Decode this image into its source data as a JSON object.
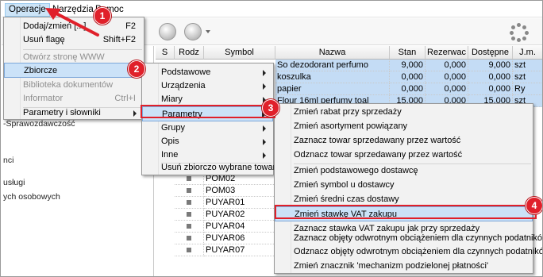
{
  "menubar": [
    "Operacje",
    "Narzędzia",
    "Pomoc"
  ],
  "tree": [
    "-Sprawozdawczość",
    "nci",
    "usługi",
    "ych osobowych"
  ],
  "grid": {
    "headers": [
      "S",
      "Rodz",
      "Symbol",
      "Nazwa",
      "Stan",
      "Rezerwac",
      "Dostępne",
      "J.m."
    ],
    "rows": [
      {
        "symbol": "",
        "name": "So dezodorant perfumo",
        "stan": "9,000",
        "rez": "0,000",
        "dost": "9,000",
        "jm": "szt"
      },
      {
        "symbol": "",
        "name": "koszulka",
        "stan": "0,000",
        "rez": "0,000",
        "dost": "0,000",
        "jm": "szt"
      },
      {
        "symbol": "",
        "name": "papier",
        "stan": "0,000",
        "rez": "0,000",
        "dost": "0,000",
        "jm": "Ry"
      },
      {
        "symbol": "",
        "name": "Flour 16ml perfumy toal",
        "stan": "15,000",
        "rez": "0,000",
        "dost": "15,000",
        "jm": "szt"
      }
    ],
    "lower_rows": [
      "POM02",
      "POM03",
      "PUYAR01",
      "PUYAR02",
      "PUYAR04",
      "PUYAR06",
      "PUYAR07"
    ]
  },
  "menu1": [
    {
      "label": "Dodaj/zmień [...]",
      "key": "F2"
    },
    {
      "label": "Usuń flagę",
      "key": "Shift+F2"
    },
    {
      "label": "Otwórz stronę WWW",
      "disabled": true
    },
    {
      "label": "Zbiorcze",
      "submenu": true
    },
    {
      "label": "Biblioteka dokumentów",
      "disabled": true
    },
    {
      "label": "Informator",
      "key": "Ctrl+I",
      "disabled": true
    },
    {
      "label": "Parametry i słowniki",
      "submenu": true
    }
  ],
  "menu2": [
    {
      "label": "Podstawowe",
      "submenu": true
    },
    {
      "label": "Urządzenia",
      "submenu": true
    },
    {
      "label": "Miary",
      "submenu": true
    },
    {
      "label": "Parametry",
      "submenu": true
    },
    {
      "label": "Grupy",
      "submenu": true
    },
    {
      "label": "Opis",
      "submenu": true
    },
    {
      "label": "Inne",
      "submenu": true
    },
    {
      "label": "Usuń zbiorczo wybrane towary"
    }
  ],
  "menu3": [
    "Zmień rabat przy sprzedaży",
    "Zmień asortyment powiązany",
    "Zaznacz towar sprzedawany przez wartość",
    "Odznacz towar sprzedawany przez wartość",
    "Zmień podstawowego dostawcę",
    "Zmień symbol u dostawcy",
    "Zmień średni czas dostawy",
    "Zmień stawkę VAT zakupu",
    "Zaznacz stawka VAT zakupu jak przy sprzedaży",
    "Zaznacz objęty odwrotnym obciążeniem dla czynnych podatników VAT",
    "Odznacz objęty odwrotnym obciążeniem dla czynnych podatników VAT",
    "Zmień znacznik 'mechanizm podzielonej płatności'"
  ],
  "badges": [
    "1",
    "2",
    "3",
    "4"
  ],
  "colors": {
    "accent_red": "#e0202a",
    "highlight": "#cbe2f8",
    "selected_row": "#c4dcf5"
  }
}
